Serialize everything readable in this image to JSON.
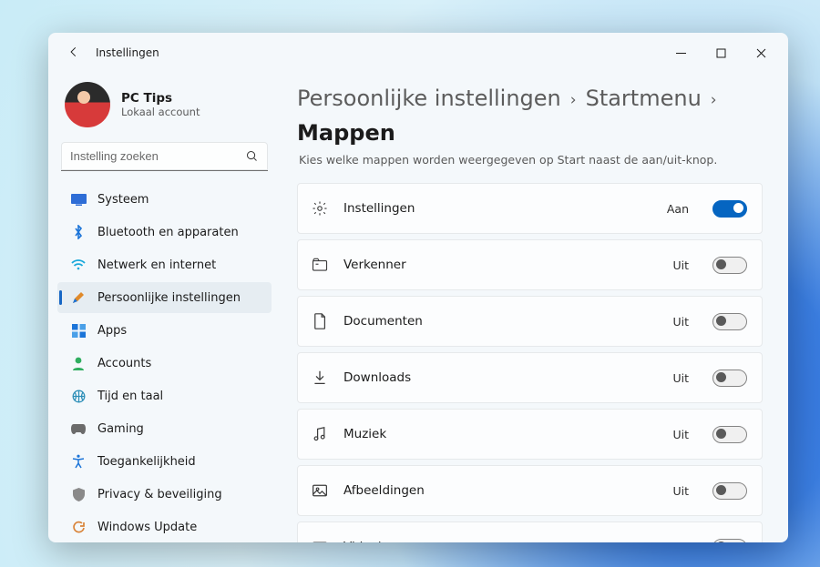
{
  "window": {
    "title": "Instellingen"
  },
  "profile": {
    "name": "PC Tips",
    "sub": "Lokaal account"
  },
  "search": {
    "placeholder": "Instelling zoeken"
  },
  "sidebar": {
    "items": [
      {
        "label": "Systeem"
      },
      {
        "label": "Bluetooth en apparaten"
      },
      {
        "label": "Netwerk en internet"
      },
      {
        "label": "Persoonlijke instellingen"
      },
      {
        "label": "Apps"
      },
      {
        "label": "Accounts"
      },
      {
        "label": "Tijd en taal"
      },
      {
        "label": "Gaming"
      },
      {
        "label": "Toegankelijkheid"
      },
      {
        "label": "Privacy & beveiliging"
      },
      {
        "label": "Windows Update"
      }
    ]
  },
  "breadcrumb": {
    "a": "Persoonlijke instellingen",
    "b": "Startmenu",
    "c": "Mappen"
  },
  "subtitle": "Kies welke mappen worden weergegeven op Start naast de aan/uit-knop.",
  "labels": {
    "on": "Aan",
    "off": "Uit"
  },
  "rows": [
    {
      "label": "Instellingen",
      "on": true
    },
    {
      "label": "Verkenner",
      "on": false
    },
    {
      "label": "Documenten",
      "on": false
    },
    {
      "label": "Downloads",
      "on": false
    },
    {
      "label": "Muziek",
      "on": false
    },
    {
      "label": "Afbeeldingen",
      "on": false
    },
    {
      "label": "Video's",
      "on": false
    }
  ]
}
